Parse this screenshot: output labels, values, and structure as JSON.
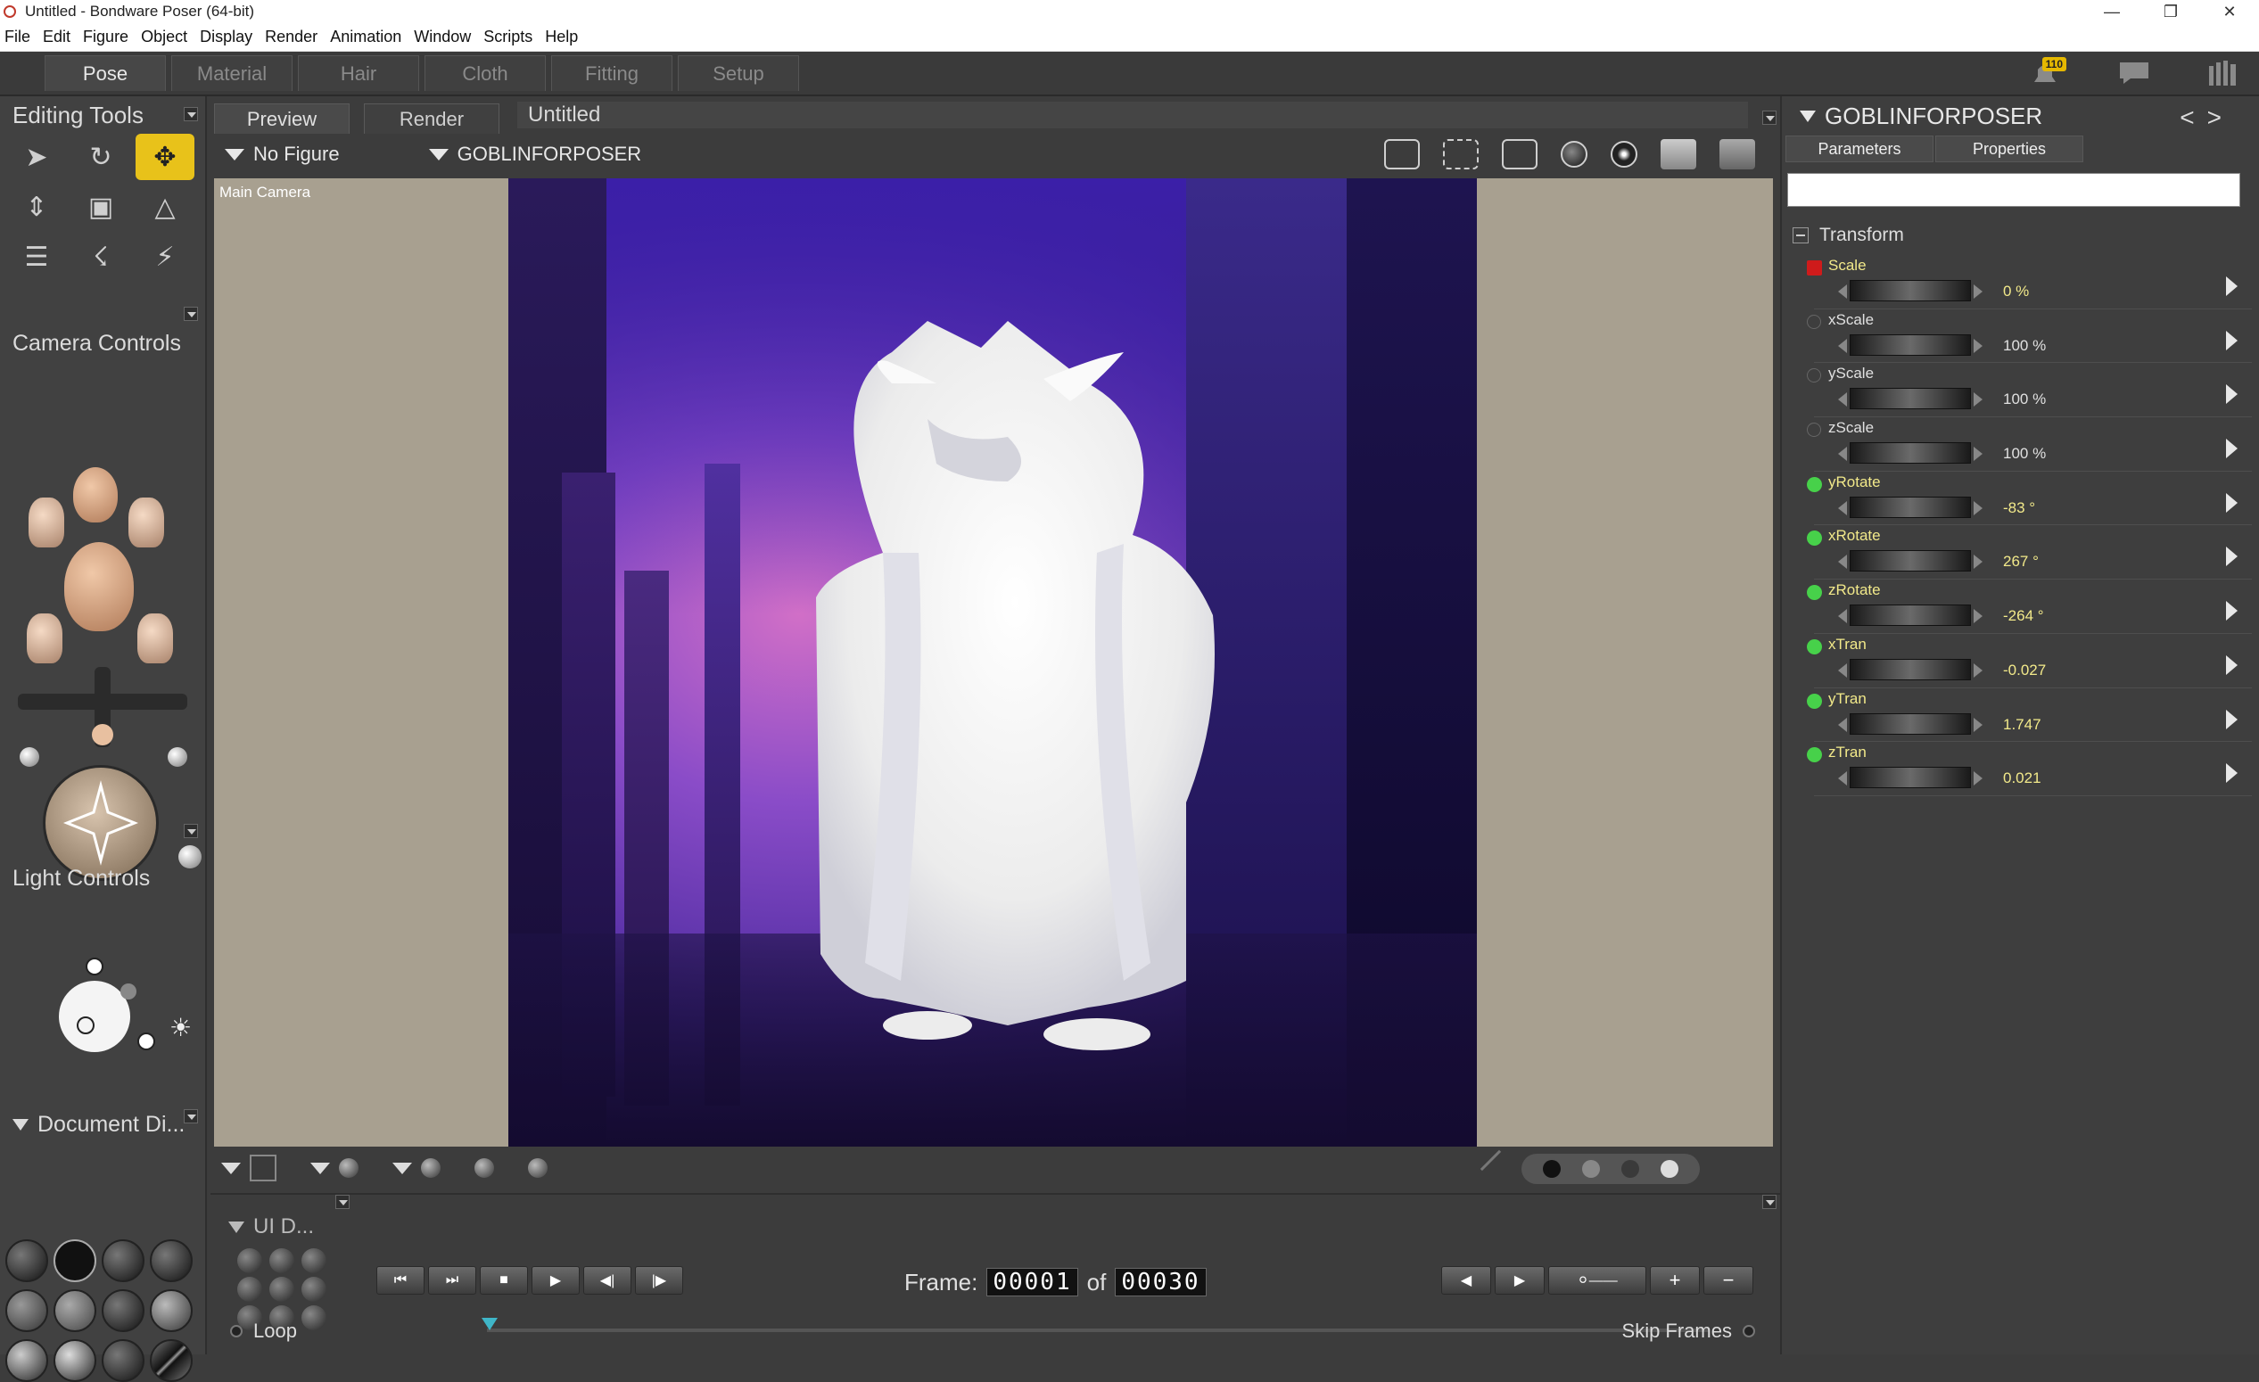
{
  "window": {
    "title": "Untitled - Bondware Poser (64-bit)"
  },
  "menu": [
    "File",
    "Edit",
    "Figure",
    "Object",
    "Display",
    "Render",
    "Animation",
    "Window",
    "Scripts",
    "Help"
  ],
  "rooms": [
    "Pose",
    "Material",
    "Hair",
    "Cloth",
    "Fitting",
    "Setup"
  ],
  "active_room": "Pose",
  "notifications": {
    "count": "110"
  },
  "left": {
    "editing_tools_title": "Editing Tools",
    "camera_controls_title": "Camera Controls",
    "light_controls_title": "Light Controls",
    "document_display_title": "Document Di..."
  },
  "viewport": {
    "tabs": [
      "Preview",
      "Render"
    ],
    "document_title": "Untitled",
    "figure_select": "No Figure",
    "actor_select": "GOBLINFORPOSER",
    "camera_label": "Main Camera"
  },
  "timeline": {
    "ui_label": "UI D...",
    "frame_label": "Frame:",
    "frame_current": "00001",
    "of_label": "of",
    "frame_total": "00030",
    "loop_label": "Loop",
    "skip_frames_label": "Skip Frames"
  },
  "right": {
    "actor_title": "GOBLINFORPOSER",
    "tabs": [
      "Parameters",
      "Properties"
    ],
    "search_placeholder": "",
    "section_title": "Transform",
    "params": [
      {
        "name": "Scale",
        "value": "0 %",
        "dot": "red",
        "color": "#f2e98a"
      },
      {
        "name": "xScale",
        "value": "100 %",
        "dot": "empty",
        "color": "#e0e0e0"
      },
      {
        "name": "yScale",
        "value": "100 %",
        "dot": "empty",
        "color": "#e0e0e0"
      },
      {
        "name": "zScale",
        "value": "100 %",
        "dot": "empty",
        "color": "#e0e0e0"
      },
      {
        "name": "yRotate",
        "value": "-83 °",
        "dot": "green",
        "color": "#f2e98a"
      },
      {
        "name": "xRotate",
        "value": "267 °",
        "dot": "green",
        "color": "#f2e98a"
      },
      {
        "name": "zRotate",
        "value": "-264 °",
        "dot": "green",
        "color": "#f2e98a"
      },
      {
        "name": "xTran",
        "value": "-0.027",
        "dot": "green",
        "color": "#f2e98a"
      },
      {
        "name": "yTran",
        "value": "1.747",
        "dot": "green",
        "color": "#f2e98a"
      },
      {
        "name": "zTran",
        "value": "0.021",
        "dot": "green",
        "color": "#f2e98a"
      }
    ]
  },
  "colors": {
    "accent_tool": "#e8c21a",
    "key_green": "#47d14a",
    "key_red": "#cf1b1b",
    "scrub_head": "#3fb6c8"
  }
}
